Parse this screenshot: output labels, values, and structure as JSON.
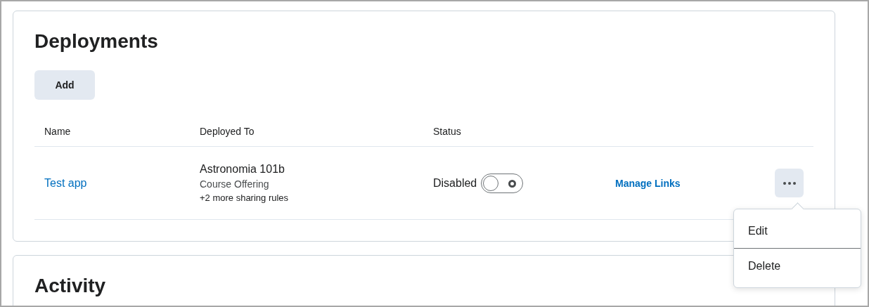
{
  "deployments": {
    "title": "Deployments",
    "add_button": "Add",
    "columns": [
      "Name",
      "Deployed To",
      "Status"
    ],
    "rows": [
      {
        "name": "Test app",
        "deployed_to": "Astronomia 101b",
        "offering_type": "Course Offering",
        "more_rules": "+2 more sharing rules",
        "status": "Disabled",
        "enabled": false,
        "link": "Manage Links",
        "menu_open": true,
        "menu_items": [
          "Edit",
          "Delete"
        ]
      }
    ]
  },
  "activity": {
    "title": "Activity"
  }
}
